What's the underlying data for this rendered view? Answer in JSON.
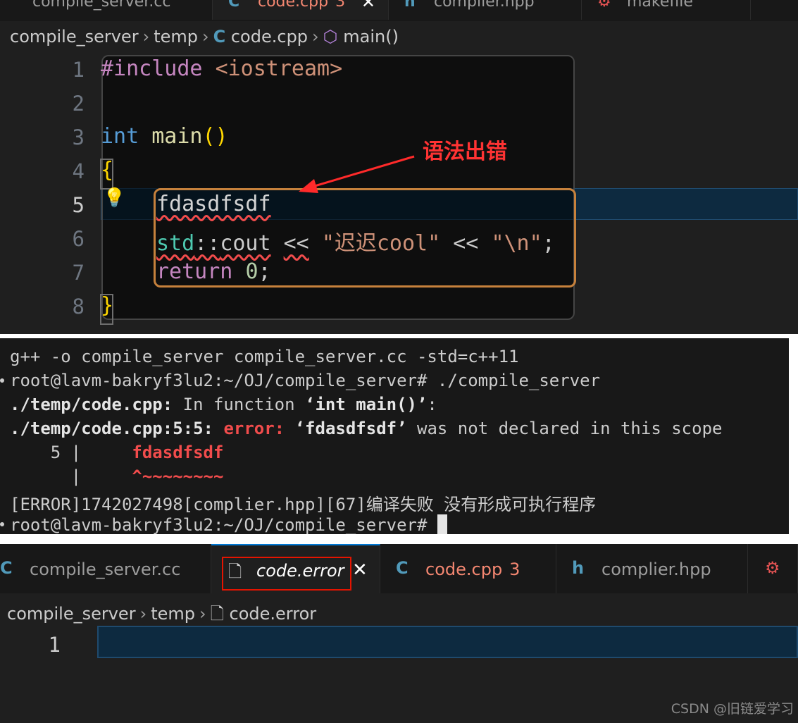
{
  "editor1": {
    "tabs": [
      {
        "label": "compile_server.cc",
        "icon": "cpp-icon"
      },
      {
        "label": "code.cpp",
        "count": "3",
        "icon": "cpp-icon",
        "active": true
      },
      {
        "label": "complier.hpp",
        "icon": "header-icon"
      },
      {
        "label": "makefile",
        "icon": "makefile-icon"
      }
    ],
    "breadcrumb": [
      "compile_server",
      "temp",
      "code.cpp",
      "main()"
    ],
    "line_numbers": [
      "1",
      "2",
      "3",
      "4",
      "5",
      "6",
      "7",
      "8"
    ],
    "code": {
      "l1_directive": "#include",
      "l1_header": "<iostream>",
      "l3_type": "int",
      "l3_func": "main",
      "l3_parens": "()",
      "l4_open": "{",
      "l5_ident": "fdasdfsdf",
      "l6_ns": "std",
      "l6_scope": "::",
      "l6_cout": "cout",
      "l6_op1": "<<",
      "l6_str1": "\"迟迟cool\"",
      "l6_op2": "<<",
      "l6_str2": "\"\\n\"",
      "l6_semi": ";",
      "l7_return": "return",
      "l7_num": "0",
      "l7_semi": ";",
      "l8_close": "}"
    },
    "annotation": "语法出错",
    "annotation_color": "#ff3333"
  },
  "terminal": {
    "line1": "g++ -o compile_server compile_server.cc -std=c++11",
    "line2": "root@lavm-bakryf3lu2:~/OJ/compile_server# ./compile_server",
    "line3_file": "./temp/code.cpp:",
    "line3_text": " In function ",
    "line3_func": "‘int main()’",
    "line3_end": ":",
    "line4_loc": "./temp/code.cpp:5:5:",
    "line4_err": "error:",
    "line4_ident": "‘fdasdfsdf’",
    "line4_text": " was not declared in this scope",
    "line5_num": "    5 |",
    "line5_code": "fdasdfsdf",
    "line6_bar": "      |",
    "line6_marker": "^~~~~~~~~",
    "line7": "[ERROR]1742027498[complier.hpp][67]编译失败 没有形成可执行程序",
    "line8": "root@lavm-bakryf3lu2:~/OJ/compile_server# "
  },
  "editor2": {
    "tabs": [
      {
        "label": "compile_server.cc",
        "icon": "cpp-icon"
      },
      {
        "label": "code.error",
        "icon": "file-icon",
        "active": true
      },
      {
        "label": "code.cpp",
        "count": "3",
        "icon": "cpp-icon"
      },
      {
        "label": "complier.hpp",
        "icon": "header-icon"
      }
    ],
    "breadcrumb": [
      "compile_server",
      "temp",
      "code.error"
    ],
    "line_number": "1"
  },
  "watermark": "CSDN @旧链爱学习",
  "colors": {
    "accent": "#0078d4",
    "error": "#f14c4c",
    "highlight_box": "#c6813c",
    "redbox": "#e51400"
  }
}
